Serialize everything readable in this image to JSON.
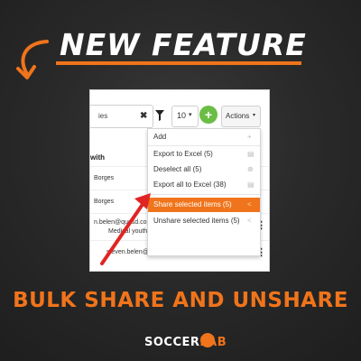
{
  "headline": "NEW FEATURE",
  "subtitle": "BULK SHARE AND UNSHARE",
  "logo": {
    "part1": "SOCCER",
    "part2": "LAB"
  },
  "toolbar": {
    "search_value": "ies",
    "clear": "✖",
    "page_size": "10",
    "caret": "▾",
    "add": "+",
    "actions": "Actions"
  },
  "table": {
    "header": "with",
    "rows": [
      {
        "text": "Borges"
      },
      {
        "text": "Borges"
      },
      {
        "text": "n.belen@quesd.com; SanderBerge; NetoBorges;",
        "text2": "Medical youth - testing the COPY"
      },
      {
        "text": "steven.belen@quesd.com"
      }
    ]
  },
  "menu": {
    "items": [
      {
        "label": "Add",
        "icon": "+"
      },
      {
        "label": "Export to Excel (5)",
        "icon": "▤"
      },
      {
        "label": "Deselect all (5)",
        "icon": "⊗"
      },
      {
        "label": "Export all to Excel (38)",
        "icon": "▤"
      },
      {
        "label": "Share selected items (5)",
        "icon": "<",
        "active": true
      },
      {
        "label": "Unshare selected items (5)",
        "icon": "<"
      }
    ]
  },
  "colors": {
    "accent": "#f0741b",
    "green": "#6abd45",
    "arrow": "#e02424"
  }
}
